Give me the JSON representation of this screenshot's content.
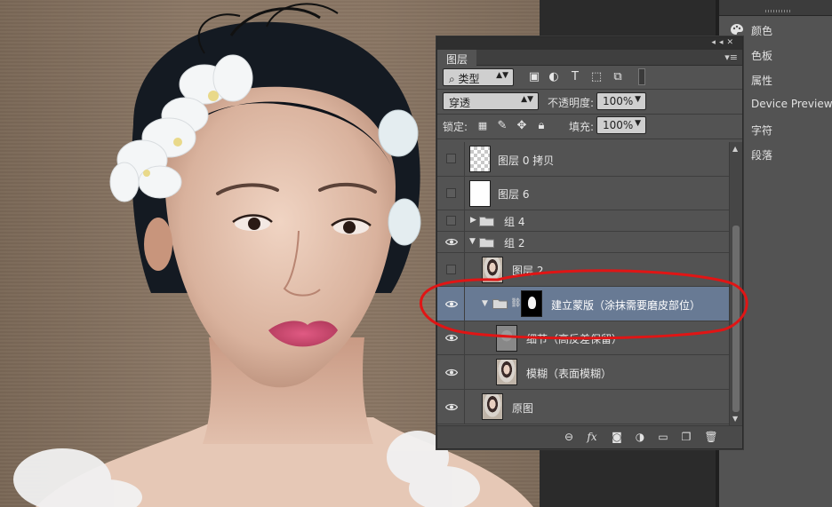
{
  "layers_panel": {
    "tab_label": "图层",
    "filter": {
      "selected": "类型"
    },
    "blend_mode": {
      "selected": "穿透"
    },
    "opacity": {
      "label": "不透明度:",
      "value": "100%"
    },
    "lock": {
      "label": "锁定:"
    },
    "fill": {
      "label": "填充:",
      "value": "100%"
    },
    "layers": [
      {
        "name": "图层 0 拷贝",
        "visible": false,
        "kind": "layer"
      },
      {
        "name": "图层 6",
        "visible": false,
        "kind": "layer"
      },
      {
        "name": "组 4",
        "visible": false,
        "kind": "group",
        "expanded": false
      },
      {
        "name": "组 2",
        "visible": true,
        "kind": "group",
        "expanded": true
      },
      {
        "name": "图层 2",
        "visible": false,
        "kind": "layer"
      },
      {
        "name": "建立蒙版（涂抹需要磨皮部位）",
        "visible": true,
        "kind": "group",
        "expanded": true,
        "selected": true,
        "has_mask": true
      },
      {
        "name": "细节（高反差保留）",
        "visible": true,
        "kind": "layer"
      },
      {
        "name": "模糊（表面模糊）",
        "visible": true,
        "kind": "layer"
      },
      {
        "name": "原图",
        "visible": true,
        "kind": "layer"
      }
    ],
    "bottom_icons": [
      "link-icon",
      "fx-icon",
      "mask-icon",
      "adjustment-icon",
      "folder-icon",
      "new-layer-icon",
      "trash-icon"
    ]
  },
  "side_panels": [
    {
      "label": "颜色",
      "icon": "palette-icon"
    },
    {
      "label": "色板",
      "icon": "swatches-icon"
    },
    {
      "label": "属性",
      "icon": "properties-icon"
    },
    {
      "label": "Device Preview",
      "icon": "device-preview-icon"
    },
    {
      "label": "字符",
      "icon": "character-icon"
    },
    {
      "label": "段落",
      "icon": "paragraph-icon"
    }
  ],
  "annotation": {
    "color": "#e01515"
  },
  "colors": {
    "selection": "#687a94",
    "panel": "#535353"
  }
}
